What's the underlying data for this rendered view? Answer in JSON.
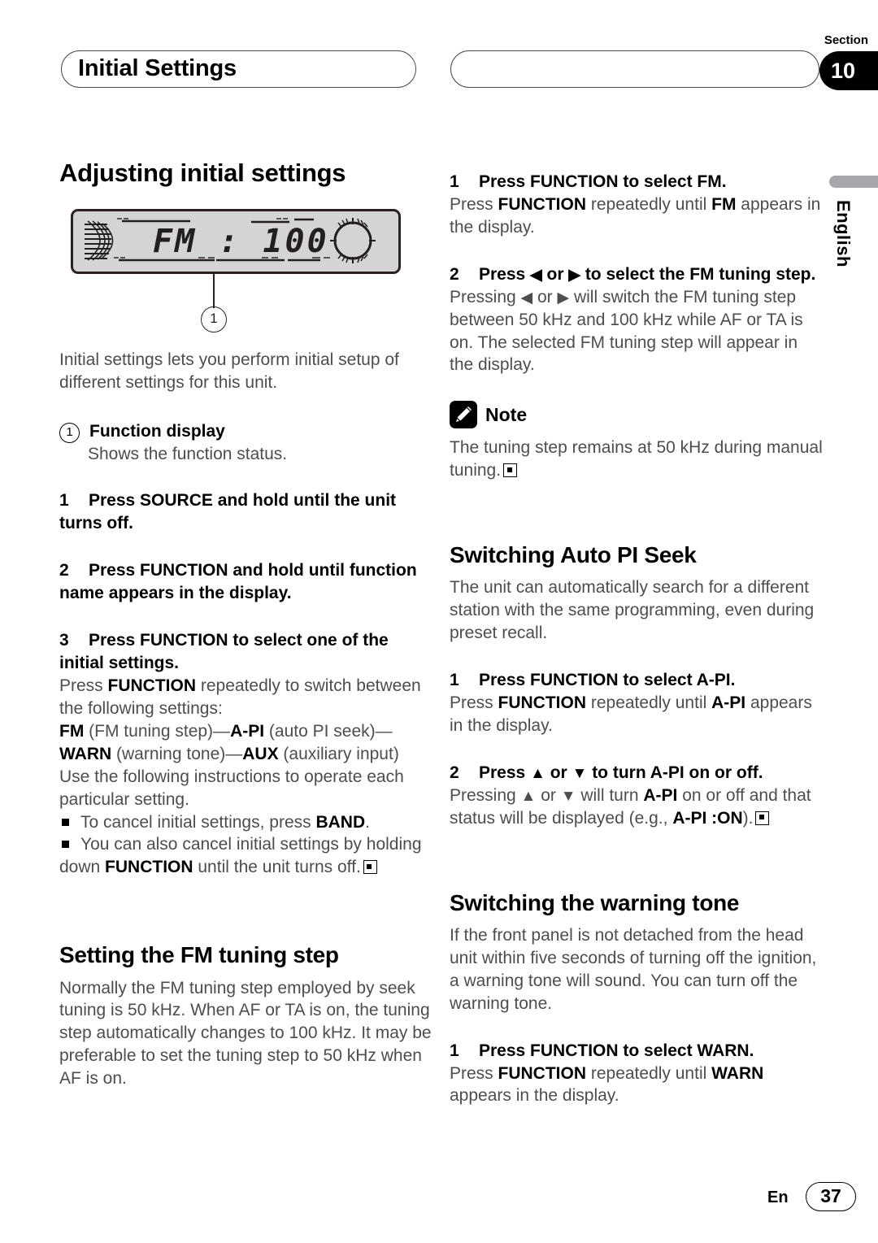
{
  "header": {
    "left_pill_title": "Initial Settings",
    "right_pill_title": "",
    "section_word": "Section",
    "section_number": "10"
  },
  "side_tab": {
    "language": "English"
  },
  "footer": {
    "lang_code": "En",
    "page_number": "37"
  },
  "device_image": {
    "display_text": "FM : 100",
    "callout_number": "1"
  },
  "left_column": {
    "heading": "Adjusting initial settings",
    "intro": "Initial settings lets you perform initial setup of different settings for this unit.",
    "callout_label": "Function display",
    "callout_number": "1",
    "callout_desc": "Shows the function status.",
    "step1_num": "1",
    "step1_text": "Press SOURCE and hold until the unit turns off.",
    "step2_num": "2",
    "step2_text": "Press FUNCTION and hold until function name appears in the display.",
    "step3_num": "3",
    "step3_text": "Press FUNCTION to select one of the initial settings.",
    "step3_body_a": "Press ",
    "step3_body_b": "FUNCTION",
    "step3_body_c": " repeatedly to switch between the following settings:",
    "settings_chain": {
      "fm": "FM",
      "fm_desc": " (FM tuning step)—",
      "api": "A-PI",
      "api_desc": " (auto PI seek)—",
      "warn": "WARN",
      "warn_desc": " (warning tone)—",
      "aux": "AUX",
      "aux_desc": " (auxiliary input)"
    },
    "step3_body_d": "Use the following instructions to operate each particular setting.",
    "bullet1_a": "To cancel initial settings, press ",
    "bullet1_b": "BAND",
    "bullet1_c": ".",
    "bullet2_a": "You can also cancel initial settings by holding down ",
    "bullet2_b": "FUNCTION",
    "bullet2_c": " until the unit turns off.",
    "fm_step_heading": "Setting the FM tuning step",
    "fm_step_body": "Normally the FM tuning step employed by seek tuning is 50 kHz. When AF or TA is on, the tuning step automatically changes to 100 kHz. It may be preferable to set the tuning step to 50 kHz when AF is on."
  },
  "right_column": {
    "fm_step1_num": "1",
    "fm_step1_text": "Press FUNCTION to select FM.",
    "fm_step1_body_a": "Press ",
    "fm_step1_body_b": "FUNCTION",
    "fm_step1_body_c": " repeatedly until ",
    "fm_step1_body_d": "FM",
    "fm_step1_body_e": " appears in the display.",
    "fm_step2_num": "2",
    "fm_step2_text_a": "Press ",
    "fm_step2_arrow_left": "◀",
    "fm_step2_text_b": " or ",
    "fm_step2_arrow_right": "▶",
    "fm_step2_text_c": " to select the FM tuning step.",
    "fm_step2_body_a": "Pressing ",
    "fm_step2_body_b": " or ",
    "fm_step2_body_c": " will switch the FM tuning step between 50 kHz and 100 kHz while AF or TA is on. The selected FM tuning step will appear in the display.",
    "note_title": "Note",
    "note_body": "The tuning step remains at 50 kHz during manual tuning.",
    "api_heading": "Switching Auto PI Seek",
    "api_body": "The unit can automatically search for a different station with the same programming, even during preset recall.",
    "api_step1_num": "1",
    "api_step1_text": "Press FUNCTION to select A-PI.",
    "api_step1_body_a": "Press ",
    "api_step1_body_b": "FUNCTION",
    "api_step1_body_c": " repeatedly until ",
    "api_step1_body_d": "A-PI",
    "api_step1_body_e": " appears in the display.",
    "api_step2_num": "2",
    "api_step2_text_a": "Press ",
    "api_step2_arrow_up": "▲",
    "api_step2_text_b": " or ",
    "api_step2_arrow_down": "▼",
    "api_step2_text_c": " to turn A-PI on or off.",
    "api_step2_body_a": "Pressing ",
    "api_step2_body_b": " or ",
    "api_step2_body_c": " will turn ",
    "api_step2_body_d": "A-PI",
    "api_step2_body_e": " on or off and that status will be displayed (e.g., ",
    "api_step2_body_f": "A-PI :ON",
    "api_step2_body_g": ").",
    "warn_heading": "Switching the warning tone",
    "warn_body": "If the front panel is not detached from the head unit within five seconds of turning off the ignition, a warning tone will sound. You can turn off the warning tone.",
    "warn_step1_num": "1",
    "warn_step1_text": "Press FUNCTION to select WARN.",
    "warn_step1_body_a": "Press ",
    "warn_step1_body_b": "FUNCTION",
    "warn_step1_body_c": " repeatedly until ",
    "warn_step1_body_d": "WARN",
    "warn_step1_body_e": " appears in the display."
  }
}
